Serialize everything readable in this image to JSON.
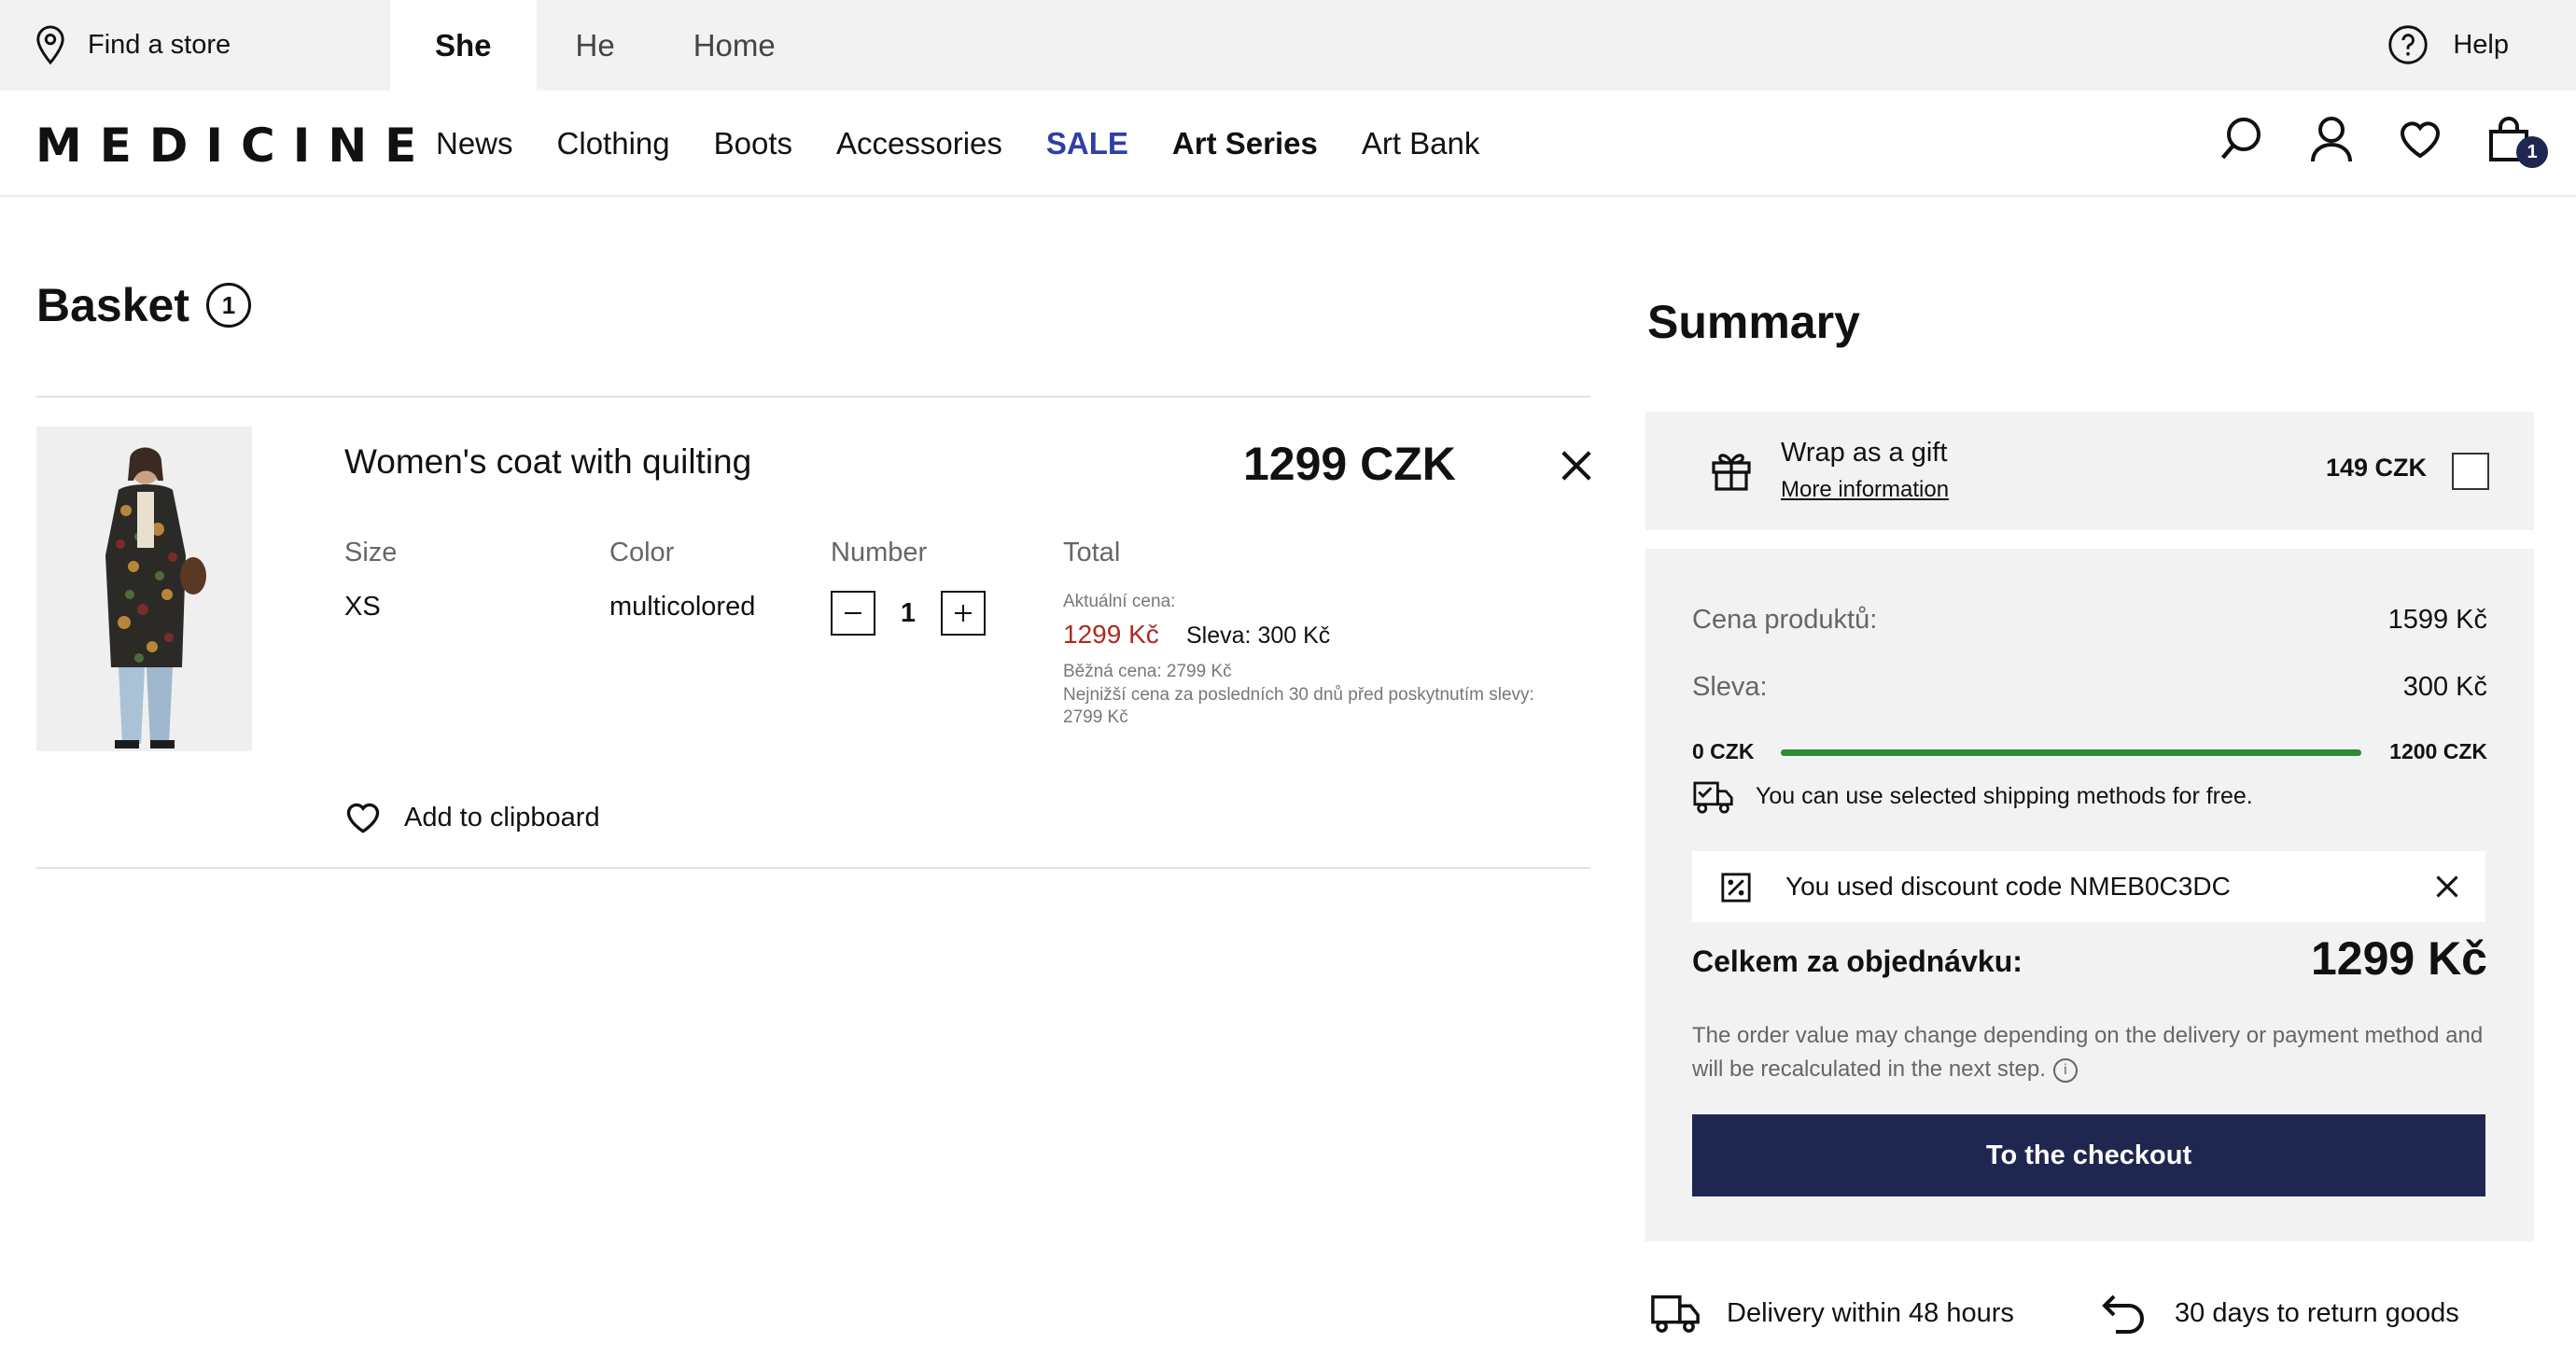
{
  "topbar": {
    "find_store": "Find a store",
    "tabs": [
      {
        "label": "She",
        "active": true
      },
      {
        "label": "He",
        "active": false
      },
      {
        "label": "Home",
        "active": false
      }
    ],
    "help": "Help"
  },
  "nav": {
    "logo": "MEDICINE",
    "links": [
      "News",
      "Clothing",
      "Boots",
      "Accessories",
      "SALE",
      "Art Series",
      "Art Bank"
    ],
    "cart_count": "1",
    "icons": [
      "search-icon",
      "user-icon",
      "heart-icon",
      "bag-icon"
    ]
  },
  "basket": {
    "title": "Basket",
    "count": "1",
    "item": {
      "name": "Women's coat with quilting",
      "price": "1299 CZK",
      "size_label": "Size",
      "size": "XS",
      "color_label": "Color",
      "color": "multicolored",
      "number_label": "Number",
      "quantity": "1",
      "total_label": "Total",
      "current_price_label": "Aktuální cena:",
      "current_price": "1299 Kč",
      "discount_label": "Sleva:",
      "discount": "300 Kč",
      "regular_price": "Běžná cena: 2799 Kč",
      "lowest_price_line1": "Nejnižší cena za posledních 30 dnů před poskytnutím slevy:",
      "lowest_price_line2": "2799 Kč",
      "add_to_clipboard": "Add to clipboard"
    }
  },
  "summary": {
    "title": "Summary",
    "gift": {
      "label": "Wrap as a gift",
      "more": "More information",
      "price": "149 CZK",
      "checked": false
    },
    "products_label": "Cena produktů:",
    "products_value": "1599 Kč",
    "discount_label": "Sleva:",
    "discount_value": "300 Kč",
    "progress": {
      "min_label": "0 CZK",
      "max_label": "1200 CZK",
      "fraction": 1.0
    },
    "shipping_note": "You can use selected shipping methods for free.",
    "discount_code_text": "You used discount code NMEB0C3DC",
    "total_label": "Celkem za objednávku:",
    "total_value": "1299 Kč",
    "note": "The order value may change depending on the delivery or payment method and will be recalculated in the next step.",
    "checkout": "To the checkout"
  },
  "perks": {
    "delivery": "Delivery within 48 hours",
    "returns": "30 days to return goods"
  },
  "colors": {
    "accent_navy": "#1f2750",
    "sale_blue": "#2f3fa5",
    "price_red": "#b02a1e",
    "progress_green": "#2f8a36"
  }
}
